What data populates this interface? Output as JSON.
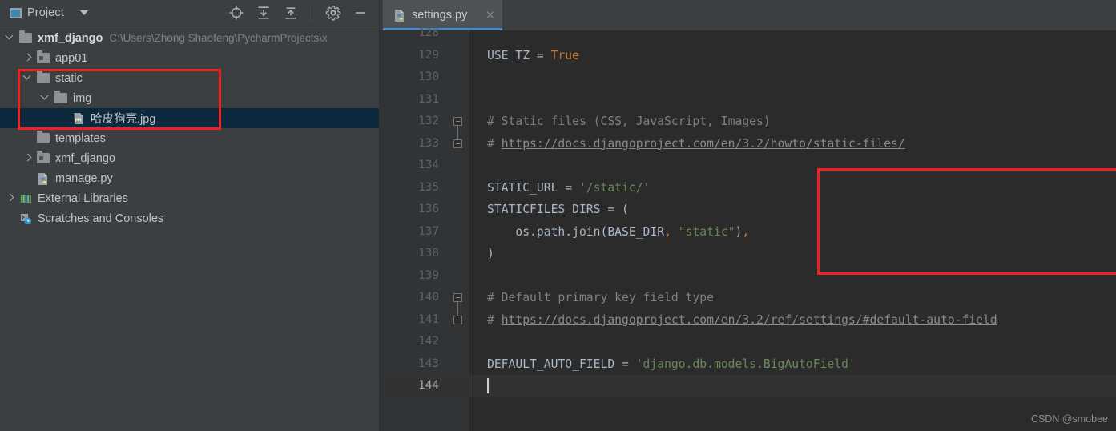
{
  "panel": {
    "title": "Project",
    "icon": "project-window-icon",
    "dropdown_icon": "chevron-down-icon",
    "toolbar": [
      {
        "name": "locate-target-icon",
        "title": "Select Opened File"
      },
      {
        "name": "expand-all-icon",
        "title": "Expand All"
      },
      {
        "name": "collapse-all-icon",
        "title": "Collapse All"
      },
      {
        "name": "gear-icon",
        "title": "Options"
      },
      {
        "name": "minimize-icon",
        "title": "Hide"
      }
    ]
  },
  "tree": [
    {
      "label": "xmf_django",
      "path": "C:\\Users\\Zhong Shaofeng\\PycharmProjects\\x",
      "indent": 0,
      "arrow": "down",
      "icon": "folder-icon",
      "bold": true,
      "selected": false
    },
    {
      "label": "app01",
      "path": "",
      "indent": 1,
      "arrow": "right",
      "icon": "folder-module-icon",
      "bold": false,
      "selected": false
    },
    {
      "label": "static",
      "path": "",
      "indent": 1,
      "arrow": "down",
      "icon": "folder-icon",
      "bold": false,
      "selected": false
    },
    {
      "label": "img",
      "path": "",
      "indent": 2,
      "arrow": "down",
      "icon": "folder-icon",
      "bold": false,
      "selected": false
    },
    {
      "label": "哈皮狗壳.jpg",
      "path": "",
      "indent": 3,
      "arrow": "none",
      "icon": "image-file-icon",
      "bold": false,
      "selected": true
    },
    {
      "label": "templates",
      "path": "",
      "indent": 1,
      "arrow": "none",
      "icon": "folder-icon",
      "bold": false,
      "selected": false
    },
    {
      "label": "xmf_django",
      "path": "",
      "indent": 1,
      "arrow": "right",
      "icon": "folder-module-icon",
      "bold": false,
      "selected": false
    },
    {
      "label": "manage.py",
      "path": "",
      "indent": 1,
      "arrow": "none",
      "icon": "python-file-icon",
      "bold": false,
      "selected": false
    },
    {
      "label": "External Libraries",
      "path": "",
      "indent": 0,
      "arrow": "right",
      "icon": "external-libraries-icon",
      "bold": false,
      "selected": false
    },
    {
      "label": "Scratches and Consoles",
      "path": "",
      "indent": 0,
      "arrow": "none",
      "icon": "scratches-icon",
      "bold": false,
      "selected": false
    }
  ],
  "editor": {
    "tab": {
      "label": "settings.py",
      "icon": "python-file-icon",
      "close_icon": "close-icon"
    },
    "active_line": 144,
    "first_visible_line": 128,
    "lines": [
      {
        "n": 128,
        "tokens": []
      },
      {
        "n": 129,
        "tokens": [
          {
            "t": "USE_TZ = ",
            "c": "t-def"
          },
          {
            "t": "True",
            "c": "t-kw"
          }
        ]
      },
      {
        "n": 130,
        "tokens": []
      },
      {
        "n": 131,
        "tokens": []
      },
      {
        "n": 132,
        "fold": "top",
        "tokens": [
          {
            "t": "# Static files (CSS, JavaScript, Images)",
            "c": "t-com"
          }
        ]
      },
      {
        "n": 133,
        "fold": "bot",
        "tokens": [
          {
            "t": "# ",
            "c": "t-com"
          },
          {
            "t": "https://docs.djangoproject.com/en/3.2/howto/static-files/",
            "c": "t-link"
          }
        ]
      },
      {
        "n": 134,
        "tokens": []
      },
      {
        "n": 135,
        "tokens": [
          {
            "t": "STATIC_URL = ",
            "c": "t-def"
          },
          {
            "t": "'/static/'",
            "c": "t-str"
          }
        ]
      },
      {
        "n": 136,
        "tokens": [
          {
            "t": "STATICFILES_DIRS = (",
            "c": "t-def"
          }
        ]
      },
      {
        "n": 137,
        "tokens": [
          {
            "t": "    os.path.join(BASE_DIR",
            "c": "t-def"
          },
          {
            "t": ",",
            "c": "t-punc"
          },
          {
            "t": " ",
            "c": "t-def"
          },
          {
            "t": "\"static\"",
            "c": "t-str"
          },
          {
            "t": ")",
            "c": "t-def"
          },
          {
            "t": ",",
            "c": "t-punc"
          }
        ]
      },
      {
        "n": 138,
        "tokens": [
          {
            "t": ")",
            "c": "t-def"
          }
        ]
      },
      {
        "n": 139,
        "tokens": []
      },
      {
        "n": 140,
        "fold": "top",
        "tokens": [
          {
            "t": "# Default primary key field type",
            "c": "t-com"
          }
        ]
      },
      {
        "n": 141,
        "fold": "bot",
        "tokens": [
          {
            "t": "# ",
            "c": "t-com"
          },
          {
            "t": "https://docs.djangoproject.com/en/3.2/ref/settings/#default-auto-field",
            "c": "t-link"
          }
        ]
      },
      {
        "n": 142,
        "tokens": []
      },
      {
        "n": 143,
        "tokens": [
          {
            "t": "DEFAULT_AUTO_FIELD = ",
            "c": "t-def"
          },
          {
            "t": "'django.db.models.BigAutoField'",
            "c": "t-str"
          }
        ]
      },
      {
        "n": 144,
        "tokens": []
      }
    ]
  },
  "annotations": {
    "color": "#f21f1f",
    "boxes": [
      {
        "name": "static-img-highlight",
        "target": "project-tree"
      },
      {
        "name": "staticfiles-dirs-highlight",
        "target": "code-block"
      }
    ]
  },
  "watermark": "CSDN @smobee"
}
